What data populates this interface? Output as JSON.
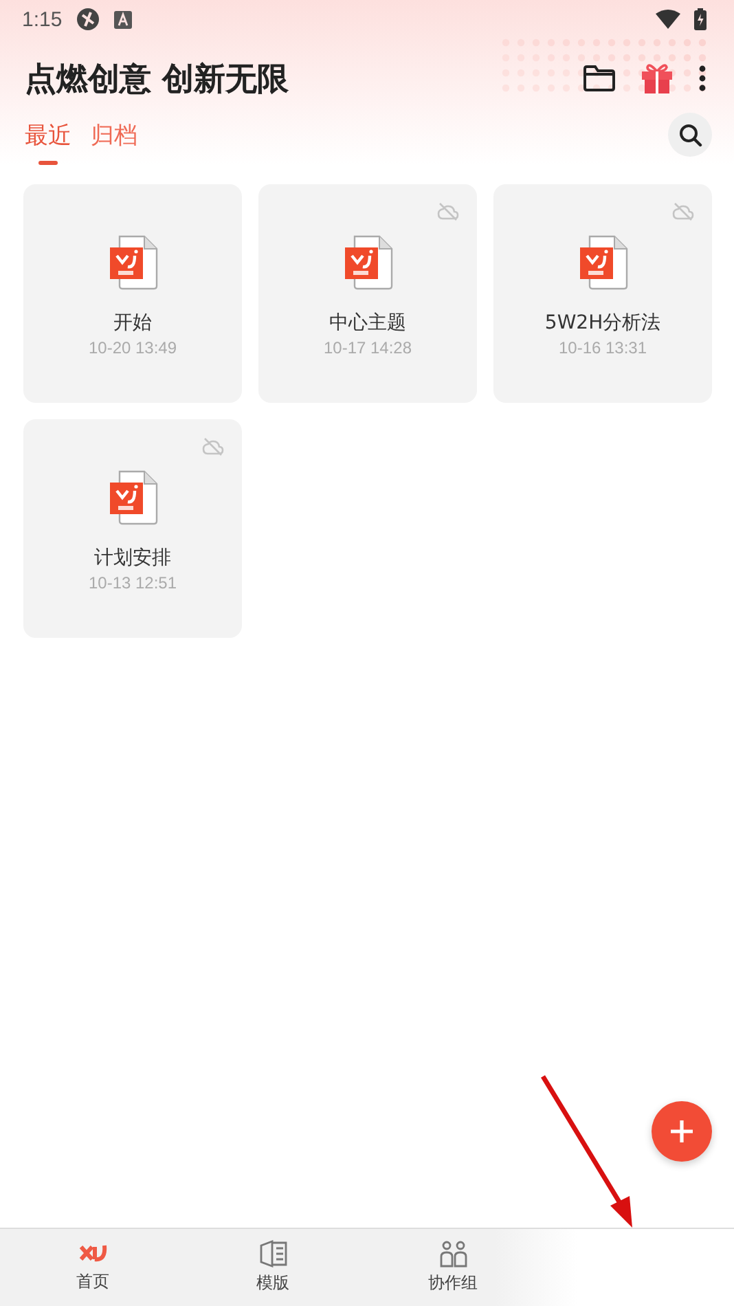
{
  "status_bar": {
    "time": "1:15"
  },
  "header": {
    "title": "点燃创意 创新无限"
  },
  "tabs": [
    {
      "label": "最近",
      "selected": true
    },
    {
      "label": "归档",
      "selected": false
    }
  ],
  "files": [
    {
      "name": "开始",
      "date": "10-20 13:49",
      "cloud_off": false
    },
    {
      "name": "中心主题",
      "date": "10-17 14:28",
      "cloud_off": true
    },
    {
      "name": "5W2H分析法",
      "date": "10-16 13:31",
      "cloud_off": true
    },
    {
      "name": "计划安排",
      "date": "10-13 12:51",
      "cloud_off": true
    }
  ],
  "bottom_nav": [
    {
      "label": "首页",
      "selected": true
    },
    {
      "label": "模版",
      "selected": false
    },
    {
      "label": "协作组",
      "selected": false
    }
  ]
}
